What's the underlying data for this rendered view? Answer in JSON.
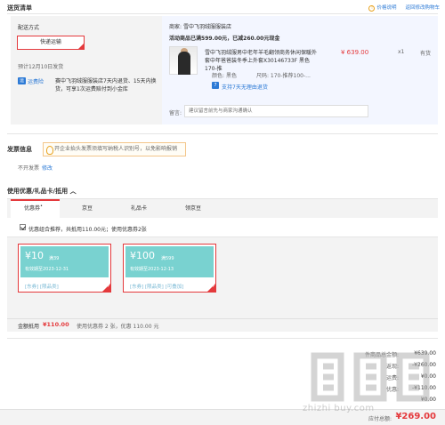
{
  "header": {
    "title": "送货清单",
    "price_info_link": "价格说明",
    "back_link": "返回修改购物车"
  },
  "shipping": {
    "label": "配送方式",
    "method": "快递运输",
    "eta": "预计12月10日发货",
    "insurance_icon": "运",
    "insurance_label": "运费险",
    "insurance_desc": "赛中飞羽绒服服装店7天内退货、15天内换货，可享1次运费赔付到小金库"
  },
  "product": {
    "seller_label": "商家:",
    "seller": "雪中飞羽绒服服装店",
    "promo_label": "活动商品已满",
    "promo_threshold": "599.00元，已减",
    "promo_saved": "260.00元现金",
    "name": "雪中飞羽绒服男中老年羊毛翻领商务休闲保暖外套中年爸爸装冬季上外套X30146733F 黑色 170-推",
    "price": "¥ 639.00",
    "qty": "x1",
    "stock": "有货",
    "color_label": "颜色:",
    "color": "黑色",
    "size_label": "尺码:",
    "size": "170-推荐100-...",
    "return_icon": "7",
    "return_text": "支持7天无理由退货",
    "memo_label": "留言:",
    "memo_placeholder": "建议留言前先与商家沟通确认"
  },
  "invoice": {
    "title": "发票信息",
    "tip": "开企业抬头发票须填写纳税人识别号，以免影响报销",
    "value": "不开发票",
    "edit": "修改"
  },
  "coupons": {
    "title": "使用优惠/礼品卡/抵用",
    "toggle": "︿",
    "tabs": [
      "优惠券",
      "京豆",
      "礼品卡",
      "领京豆"
    ],
    "active_tab_marker": "•",
    "combo_text": "优惠组合推荐，共抵用110.00元；使用优惠券2张",
    "items": [
      {
        "amount": "¥10",
        "condition": "满39",
        "valid": "有效期至2023-12-31",
        "tags": "[东券]  [限品类]"
      },
      {
        "amount": "¥100",
        "condition": "满599",
        "valid": "有效期至2023-12-13",
        "tags": "[东券]  [限品类]  [可叠加]"
      }
    ],
    "discount_label": "金额抵用",
    "discount_value": "¥110.00",
    "discount_detail": "使用优惠券 2 张，优惠 110.00 元"
  },
  "summary": {
    "rows": [
      {
        "label": "件商品总金额:",
        "value": "¥639.00"
      },
      {
        "label": "返现:",
        "value": "-¥260.00"
      },
      {
        "label": "运费:",
        "value": "¥0.00"
      },
      {
        "label": "优惠:",
        "value": "-¥110.00"
      },
      {
        "label": "",
        "value": "¥0.00"
      }
    ],
    "total_label": "应付总额:",
    "total_value": "¥269.00"
  },
  "watermark": {
    "text": "zhizhi buy.com"
  },
  "colors": {
    "accent": "#e4393c",
    "link": "#2c7ad6",
    "coupon_bg": "#79d2d0"
  }
}
